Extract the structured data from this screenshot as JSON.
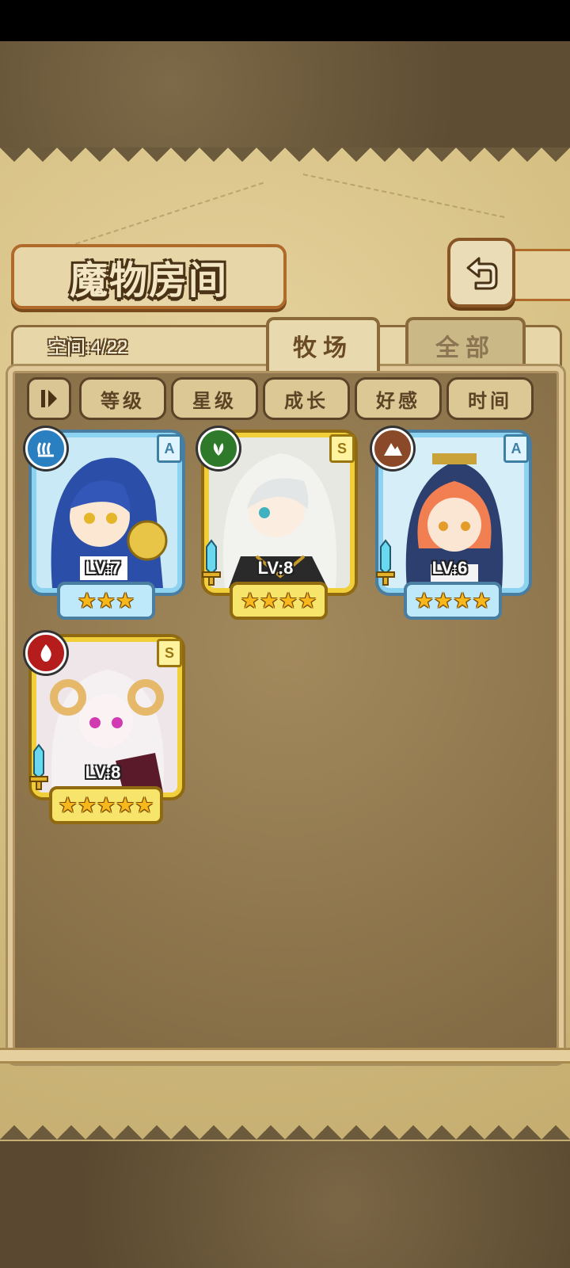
{
  "header": {
    "title": "魔物房间",
    "back_icon": "return-arrow-icon"
  },
  "tabs": {
    "space_label": "空间:4/22",
    "items": [
      {
        "label": "牧场",
        "active": true
      },
      {
        "label": "全部",
        "active": false
      }
    ]
  },
  "sort_bar": {
    "toggle_icon": "sort-toggle-icon",
    "buttons": [
      "等级",
      "星级",
      "成长",
      "好感",
      "时间"
    ]
  },
  "monsters": [
    {
      "level": "LV:7",
      "rank": "A",
      "stars": "★★★",
      "star_count": 3,
      "element": "water",
      "element_color": "#2a7fc1",
      "frame": "blue",
      "has_sword": false
    },
    {
      "level": "LV:8",
      "rank": "S",
      "stars": "★★★★",
      "star_count": 4,
      "element": "nature",
      "element_color": "#2f7a2a",
      "frame": "gold",
      "has_sword": true
    },
    {
      "level": "LV:6",
      "rank": "A",
      "stars": "★★★★",
      "star_count": 4,
      "element": "earth",
      "element_color": "#8a4a2a",
      "frame": "blue",
      "has_sword": true
    },
    {
      "level": "LV:8",
      "rank": "S",
      "stars": "★★★★★",
      "star_count": 5,
      "element": "fire",
      "element_color": "#b51c1c",
      "frame": "gold",
      "has_sword": true
    }
  ],
  "colors": {
    "accent_border": "#b06a2a",
    "parchment": "#d7c185",
    "panel": "#8e754c"
  }
}
